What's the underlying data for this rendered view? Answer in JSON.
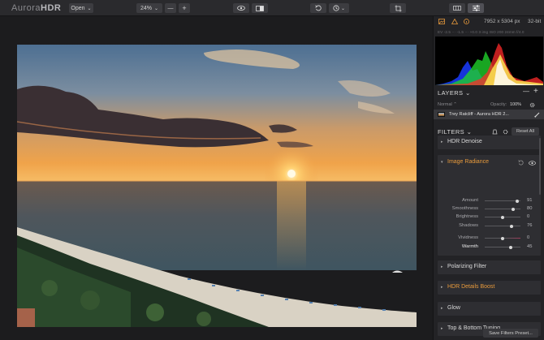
{
  "app": {
    "logo_prefix": "Aurora",
    "logo_suffix": "HDR"
  },
  "toolbar": {
    "open_label": "Open",
    "open_chevron": "⌄",
    "zoom_value": "24%",
    "zoom_minus": "—",
    "zoom_plus": "+"
  },
  "image_info": {
    "dimensions": "7952 x 5304 px",
    "bit_depth": "32-bit",
    "exif": "EV  -2.5 ··· -1.5 ··· +0.0    3 img   ISO 200   24mm   f/4.0"
  },
  "layers": {
    "header": "LAYERS",
    "chevron": "⌄",
    "blend_mode": "Normal ⌃",
    "opacity_label": "Opacity:",
    "opacity_value": "100%",
    "add": "+",
    "remove": "—",
    "layer_name": "Trey Ratcliff - Aurora HDR 2..."
  },
  "filters": {
    "header": "FILTERS",
    "chevron": "⌄",
    "reset_all": "Reset All",
    "items": [
      {
        "name": "HDR Denoise"
      },
      {
        "name": "Image Radiance"
      },
      {
        "name": "Polarizing Filter"
      },
      {
        "name": "HDR Details Boost"
      },
      {
        "name": "Glow"
      },
      {
        "name": "Top & Bottom Tuning"
      }
    ],
    "sliders": [
      {
        "label": "Amount",
        "value": "91",
        "level": 0.91
      },
      {
        "label": "Smoothness",
        "value": "80",
        "level": 0.8
      },
      {
        "label": "Brightness",
        "value": "0",
        "level": 0.5
      },
      {
        "label": "Shadows",
        "value": "76",
        "level": 0.76
      },
      {
        "label": "Vividness",
        "value": "0",
        "level": 0.5
      },
      {
        "label": "Warmth",
        "value": "45",
        "level": 0.725
      }
    ],
    "save_preset": "Save Filters Preset..."
  }
}
